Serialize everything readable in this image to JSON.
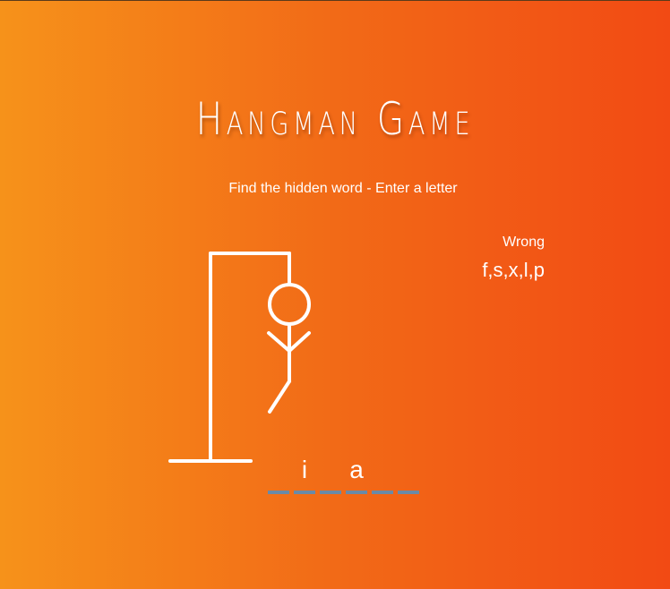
{
  "title": "Hangman Game",
  "subtitle": "Find the hidden word - Enter a letter",
  "wrong": {
    "label": "Wrong",
    "letters": "f,s,x,l,p",
    "count": 5
  },
  "word": {
    "slots": [
      "",
      "i",
      "",
      "a",
      "",
      ""
    ]
  },
  "colors": {
    "gradient_start": "#f6921a",
    "gradient_end": "#f24a14",
    "figure": "#ffffff",
    "blank_underline": "#6b8aa6"
  },
  "icons": {
    "figure": "hangman-figure-icon"
  }
}
